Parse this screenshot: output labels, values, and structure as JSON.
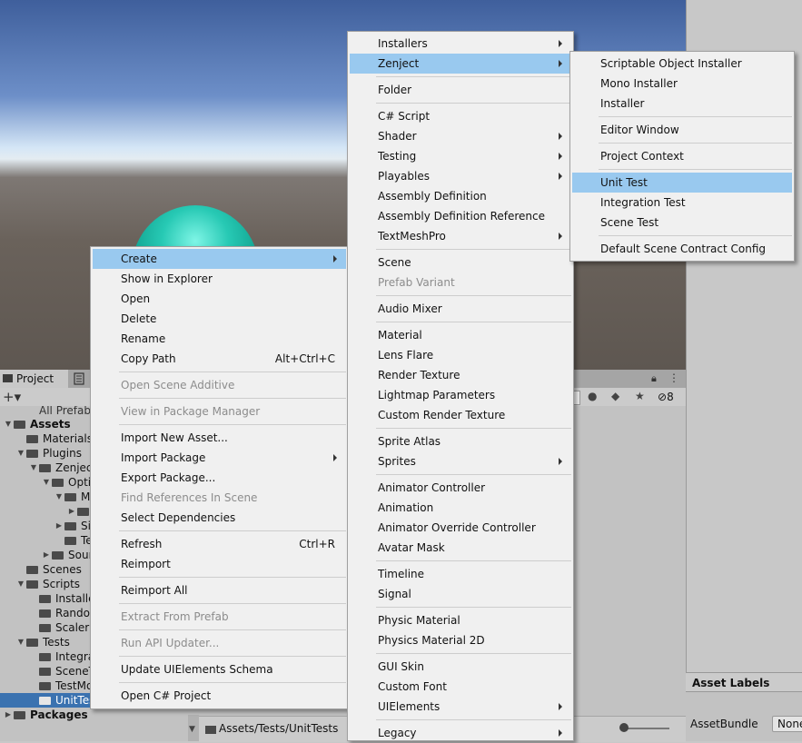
{
  "project_panel": {
    "tab_label": "Project",
    "hidden_count": "8",
    "partial_search_text": "All Prefab",
    "breadcrumb_path": "Assets/Tests/UnitTests"
  },
  "tree": [
    {
      "label": "Assets",
      "indent": 0,
      "expanded": true,
      "bold": true
    },
    {
      "label": "Materials",
      "indent": 1
    },
    {
      "label": "Plugins",
      "indent": 1,
      "expanded": true
    },
    {
      "label": "Zenject",
      "indent": 2,
      "expanded": true
    },
    {
      "label": "Optic",
      "indent": 3,
      "expanded": true
    },
    {
      "label": "Me",
      "indent": 4,
      "expanded": true
    },
    {
      "label": "",
      "indent": 5,
      "collapsed": true
    },
    {
      "label": "Sig",
      "indent": 4,
      "collapsed": true
    },
    {
      "label": "Te",
      "indent": 4
    },
    {
      "label": "Sourc",
      "indent": 3,
      "collapsed": true
    },
    {
      "label": "Scenes",
      "indent": 1
    },
    {
      "label": "Scripts",
      "indent": 1,
      "expanded": true
    },
    {
      "label": "Installer",
      "indent": 2
    },
    {
      "label": "Random",
      "indent": 2
    },
    {
      "label": "Scaler",
      "indent": 2
    },
    {
      "label": "Tests",
      "indent": 1,
      "expanded": true
    },
    {
      "label": "Integrat",
      "indent": 2
    },
    {
      "label": "SceneT",
      "indent": 2
    },
    {
      "label": "TestMo",
      "indent": 2
    },
    {
      "label": "UnitTests",
      "indent": 2,
      "selected": true
    },
    {
      "label": "Packages",
      "indent": 0,
      "collapsed": true,
      "bold": true
    }
  ],
  "inspector": {
    "asset_labels_title": "Asset Labels",
    "asset_bundle_label": "AssetBundle",
    "asset_bundle_value": "None"
  },
  "context_menu": {
    "items": [
      {
        "label": "Create",
        "submenu": true,
        "highlighted": true
      },
      {
        "label": "Show in Explorer"
      },
      {
        "label": "Open"
      },
      {
        "label": "Delete"
      },
      {
        "label": "Rename"
      },
      {
        "label": "Copy Path",
        "shortcut": "Alt+Ctrl+C"
      },
      {
        "separator": true
      },
      {
        "label": "Open Scene Additive",
        "disabled": true
      },
      {
        "separator": true
      },
      {
        "label": "View in Package Manager",
        "disabled": true
      },
      {
        "separator": true
      },
      {
        "label": "Import New Asset..."
      },
      {
        "label": "Import Package",
        "submenu": true
      },
      {
        "label": "Export Package..."
      },
      {
        "label": "Find References In Scene",
        "disabled": true
      },
      {
        "label": "Select Dependencies"
      },
      {
        "separator": true
      },
      {
        "label": "Refresh",
        "shortcut": "Ctrl+R"
      },
      {
        "label": "Reimport"
      },
      {
        "separator": true
      },
      {
        "label": "Reimport All"
      },
      {
        "separator": true
      },
      {
        "label": "Extract From Prefab",
        "disabled": true
      },
      {
        "separator": true
      },
      {
        "label": "Run API Updater...",
        "disabled": true
      },
      {
        "separator": true
      },
      {
        "label": "Update UIElements Schema"
      },
      {
        "separator": true
      },
      {
        "label": "Open C# Project"
      }
    ]
  },
  "create_menu": {
    "items": [
      {
        "label": "Installers",
        "submenu": true
      },
      {
        "label": "Zenject",
        "submenu": true,
        "highlighted": true
      },
      {
        "separator": true
      },
      {
        "label": "Folder"
      },
      {
        "separator": true
      },
      {
        "label": "C# Script"
      },
      {
        "label": "Shader",
        "submenu": true
      },
      {
        "label": "Testing",
        "submenu": true
      },
      {
        "label": "Playables",
        "submenu": true
      },
      {
        "label": "Assembly Definition"
      },
      {
        "label": "Assembly Definition Reference"
      },
      {
        "label": "TextMeshPro",
        "submenu": true
      },
      {
        "separator": true
      },
      {
        "label": "Scene"
      },
      {
        "label": "Prefab Variant",
        "disabled": true
      },
      {
        "separator": true
      },
      {
        "label": "Audio Mixer"
      },
      {
        "separator": true
      },
      {
        "label": "Material"
      },
      {
        "label": "Lens Flare"
      },
      {
        "label": "Render Texture"
      },
      {
        "label": "Lightmap Parameters"
      },
      {
        "label": "Custom Render Texture"
      },
      {
        "separator": true
      },
      {
        "label": "Sprite Atlas"
      },
      {
        "label": "Sprites",
        "submenu": true
      },
      {
        "separator": true
      },
      {
        "label": "Animator Controller"
      },
      {
        "label": "Animation"
      },
      {
        "label": "Animator Override Controller"
      },
      {
        "label": "Avatar Mask"
      },
      {
        "separator": true
      },
      {
        "label": "Timeline"
      },
      {
        "label": "Signal"
      },
      {
        "separator": true
      },
      {
        "label": "Physic Material"
      },
      {
        "label": "Physics Material 2D"
      },
      {
        "separator": true
      },
      {
        "label": "GUI Skin"
      },
      {
        "label": "Custom Font"
      },
      {
        "label": "UIElements",
        "submenu": true
      },
      {
        "separator": true
      },
      {
        "label": "Legacy",
        "submenu": true
      }
    ]
  },
  "zenject_menu": {
    "items": [
      {
        "label": "Scriptable Object Installer"
      },
      {
        "label": "Mono Installer"
      },
      {
        "label": "Installer"
      },
      {
        "separator": true
      },
      {
        "label": "Editor Window"
      },
      {
        "separator": true
      },
      {
        "label": "Project Context"
      },
      {
        "separator": true
      },
      {
        "label": "Unit Test",
        "highlighted": true
      },
      {
        "label": "Integration Test"
      },
      {
        "label": "Scene Test"
      },
      {
        "separator": true
      },
      {
        "label": "Default Scene Contract Config"
      }
    ]
  }
}
